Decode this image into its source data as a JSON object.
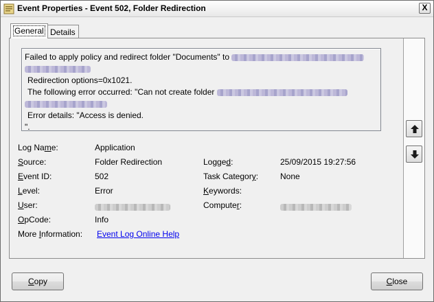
{
  "window": {
    "title": "Event Properties - Event 502, Folder Redirection",
    "close_glyph": "X"
  },
  "tabs": [
    {
      "label": "General",
      "active": true
    },
    {
      "label": "Details",
      "active": false
    }
  ],
  "message": {
    "line1": "Failed to apply policy and redirect folder \"Documents\" to",
    "line3": "Redirection options=0x1021.",
    "line4": "The following error occurred: \"Can not create folder",
    "line6": "Error details: \"Access is denied.",
    "line7": "\"."
  },
  "fields": {
    "log_name_label": "Log Name:",
    "log_name": "Application",
    "source_label": "Source:",
    "source": "Folder Redirection",
    "event_id_label": "Event ID:",
    "event_id": "502",
    "level_label": "Level:",
    "level": "Error",
    "user_label": "User:",
    "opcode_label": "OpCode:",
    "opcode": "Info",
    "more_info_label": "More Information:",
    "more_info_link": "Event Log Online Help",
    "logged_label": "Logged:",
    "logged": "25/09/2015 19:27:56",
    "task_category_label": "Task Category:",
    "task_category": "None",
    "keywords_label": "Keywords:",
    "computer_label": "Computer:"
  },
  "buttons": {
    "copy": "Copy",
    "close": "Close"
  },
  "icons": {
    "up": "arrow-up-icon",
    "down": "arrow-down-icon",
    "title": "event-viewer-icon"
  }
}
